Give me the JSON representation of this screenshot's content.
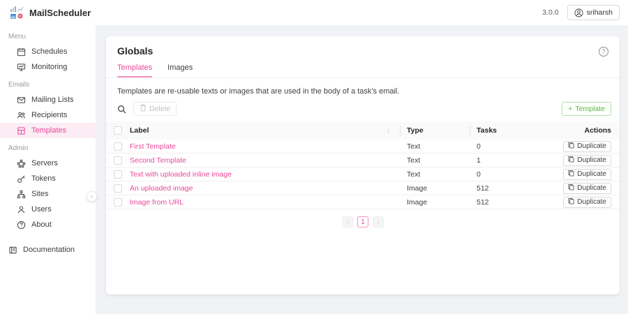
{
  "app": {
    "title": "MailScheduler",
    "version": "3.0.0",
    "user": "sriharsh"
  },
  "sidebar": {
    "sections": [
      {
        "label": "Menu",
        "items": [
          {
            "label": "Schedules",
            "icon": "calendar-icon"
          },
          {
            "label": "Monitoring",
            "icon": "monitor-icon"
          }
        ]
      },
      {
        "label": "Emails",
        "items": [
          {
            "label": "Mailing Lists",
            "icon": "mail-icon"
          },
          {
            "label": "Recipients",
            "icon": "team-icon"
          },
          {
            "label": "Templates",
            "icon": "layout-icon",
            "active": true
          }
        ]
      },
      {
        "label": "Admin",
        "items": [
          {
            "label": "Servers",
            "icon": "cluster-icon"
          },
          {
            "label": "Tokens",
            "icon": "key-icon"
          },
          {
            "label": "Sites",
            "icon": "sitemap-icon"
          },
          {
            "label": "Users",
            "icon": "user-icon"
          },
          {
            "label": "About",
            "icon": "question-icon"
          }
        ]
      }
    ],
    "documentation": {
      "label": "Documentation",
      "icon": "book-icon"
    }
  },
  "main": {
    "title": "Globals",
    "tabs": [
      {
        "label": "Templates",
        "active": true
      },
      {
        "label": "Images",
        "active": false
      }
    ],
    "description": "Templates are re-usable texts or images that are used in the body of a task's email.",
    "toolbar": {
      "delete_label": "Delete",
      "add_label": "Template",
      "add_plus": "+"
    },
    "table": {
      "columns": [
        "Label",
        "Type",
        "Tasks",
        "Actions"
      ],
      "sort_indicator": "↓",
      "rows": [
        {
          "label": "First Template",
          "type": "Text",
          "tasks": "0",
          "action": "Duplicate"
        },
        {
          "label": "Second Template",
          "type": "Text",
          "tasks": "1",
          "action": "Duplicate"
        },
        {
          "label": "Text with uploaded inline image",
          "type": "Text",
          "tasks": "0",
          "action": "Duplicate"
        },
        {
          "label": "An uploaded image",
          "type": "Image",
          "tasks": "512",
          "action": "Duplicate"
        },
        {
          "label": "Image from URL",
          "type": "Image",
          "tasks": "512",
          "action": "Duplicate"
        }
      ]
    },
    "pagination": {
      "prev": "‹",
      "current": "1",
      "next": "›"
    },
    "help_glyph": "?",
    "collapse_glyph": "‹"
  },
  "colors": {
    "accent": "#e9489a",
    "accent_underline": "#f391c3",
    "accent_bg": "#fcecf4",
    "green": "#57b846",
    "green_border": "#b5e0ac",
    "gray_bg": "#f0f2f5"
  }
}
